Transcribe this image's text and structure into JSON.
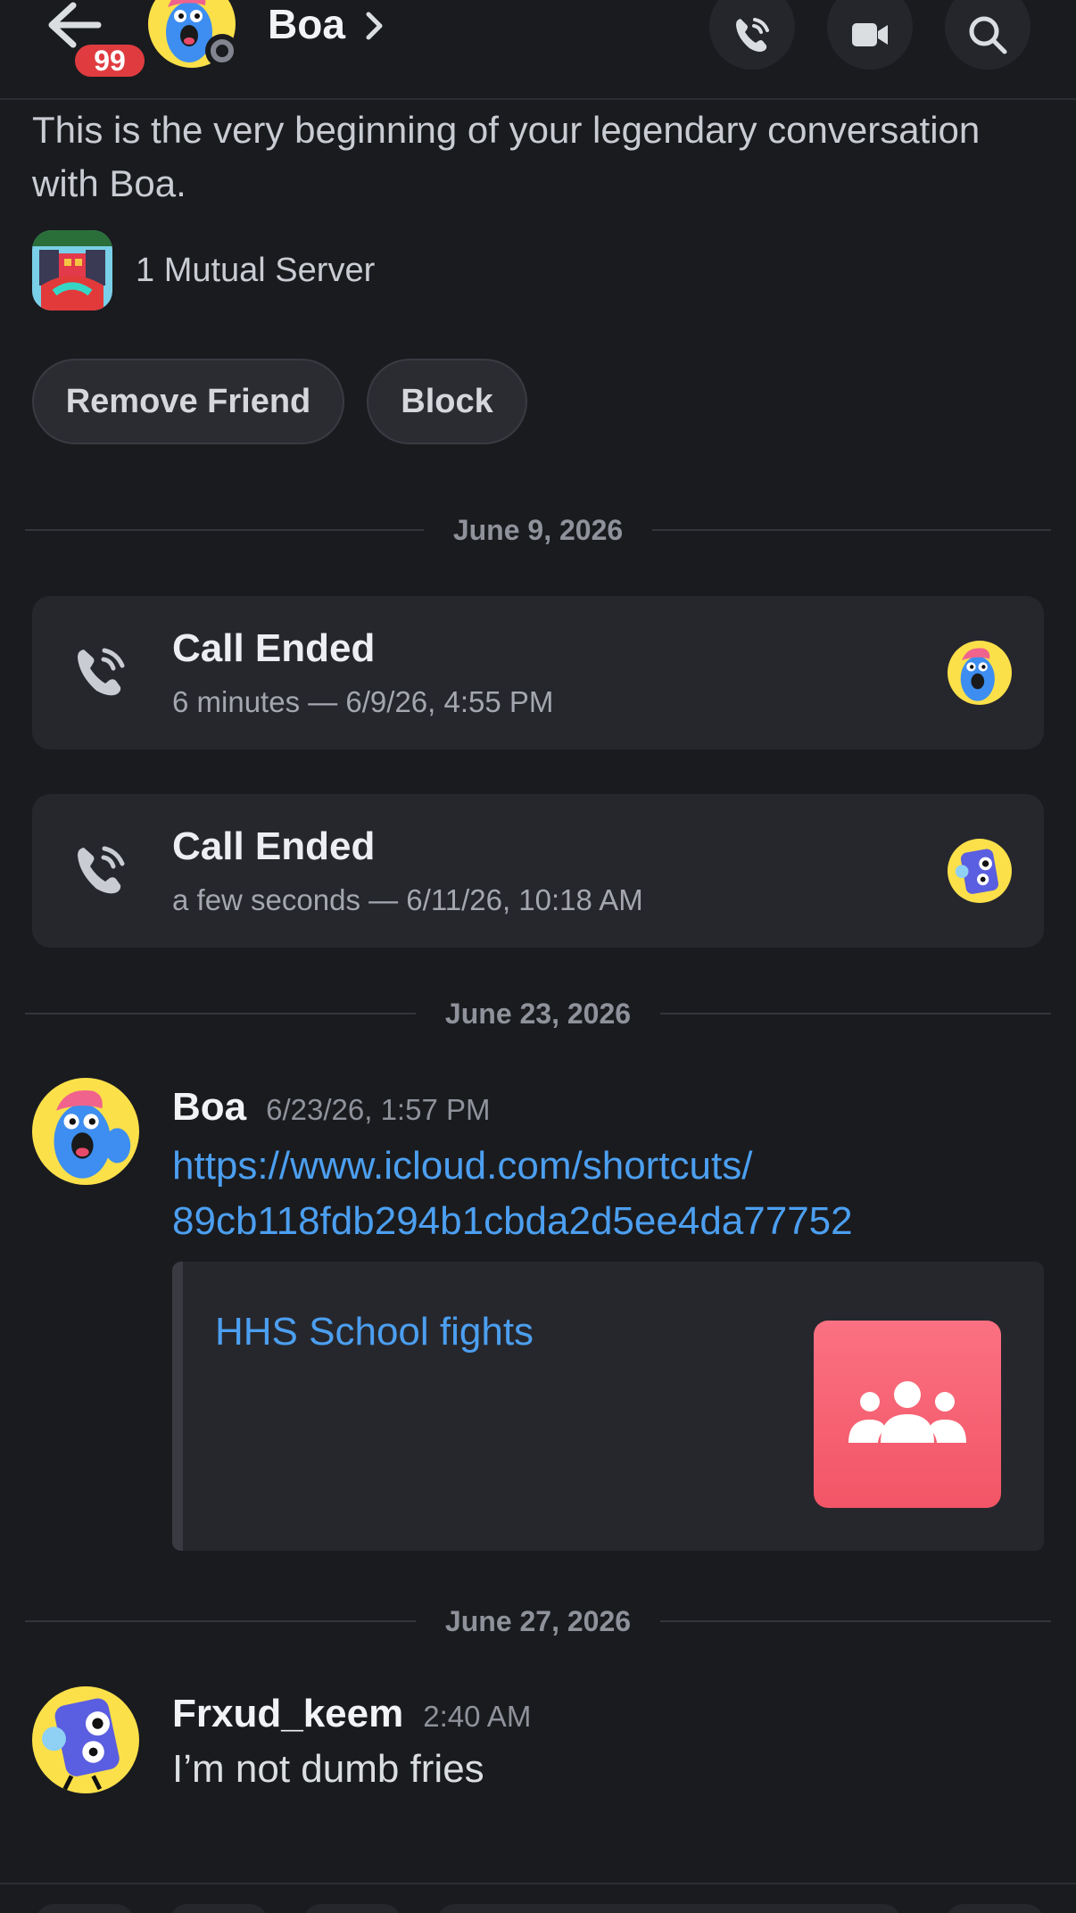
{
  "header": {
    "unread_count": "99",
    "contact_name": "Boa"
  },
  "intro": {
    "text": "This is the very beginning of your legendary conversation with Boa.",
    "mutual_servers": "1 Mutual Server",
    "remove_friend_label": "Remove Friend",
    "block_label": "Block"
  },
  "dates": [
    "June 9, 2026",
    "June 23, 2026",
    "June 27, 2026"
  ],
  "calls": [
    {
      "title": "Call Ended",
      "meta": "6 minutes — 6/9/26, 4:55 PM",
      "avatar": "boa-avatar"
    },
    {
      "title": "Call Ended",
      "meta": "a few seconds — 6/11/26, 10:18 AM",
      "avatar": "frxud-avatar"
    }
  ],
  "messages": [
    {
      "author": "Boa",
      "time": "6/23/26, 1:57 PM",
      "link_line1": "https://www.icloud.com/shortcuts/",
      "link_line2": "89cb118fdb294b1cbda2d5ee4da77752",
      "embed_title": "HHS School fights",
      "embed_icon": "people-group-icon"
    },
    {
      "author": "Frxud_keem",
      "time": "2:40 AM",
      "body": "I’m not dumb fries"
    }
  ],
  "colors": {
    "background": "#1a1b1f",
    "card": "#26272d",
    "link": "#4c9ff0",
    "badge": "#e03c40",
    "embed_thumb": "#f25566"
  }
}
